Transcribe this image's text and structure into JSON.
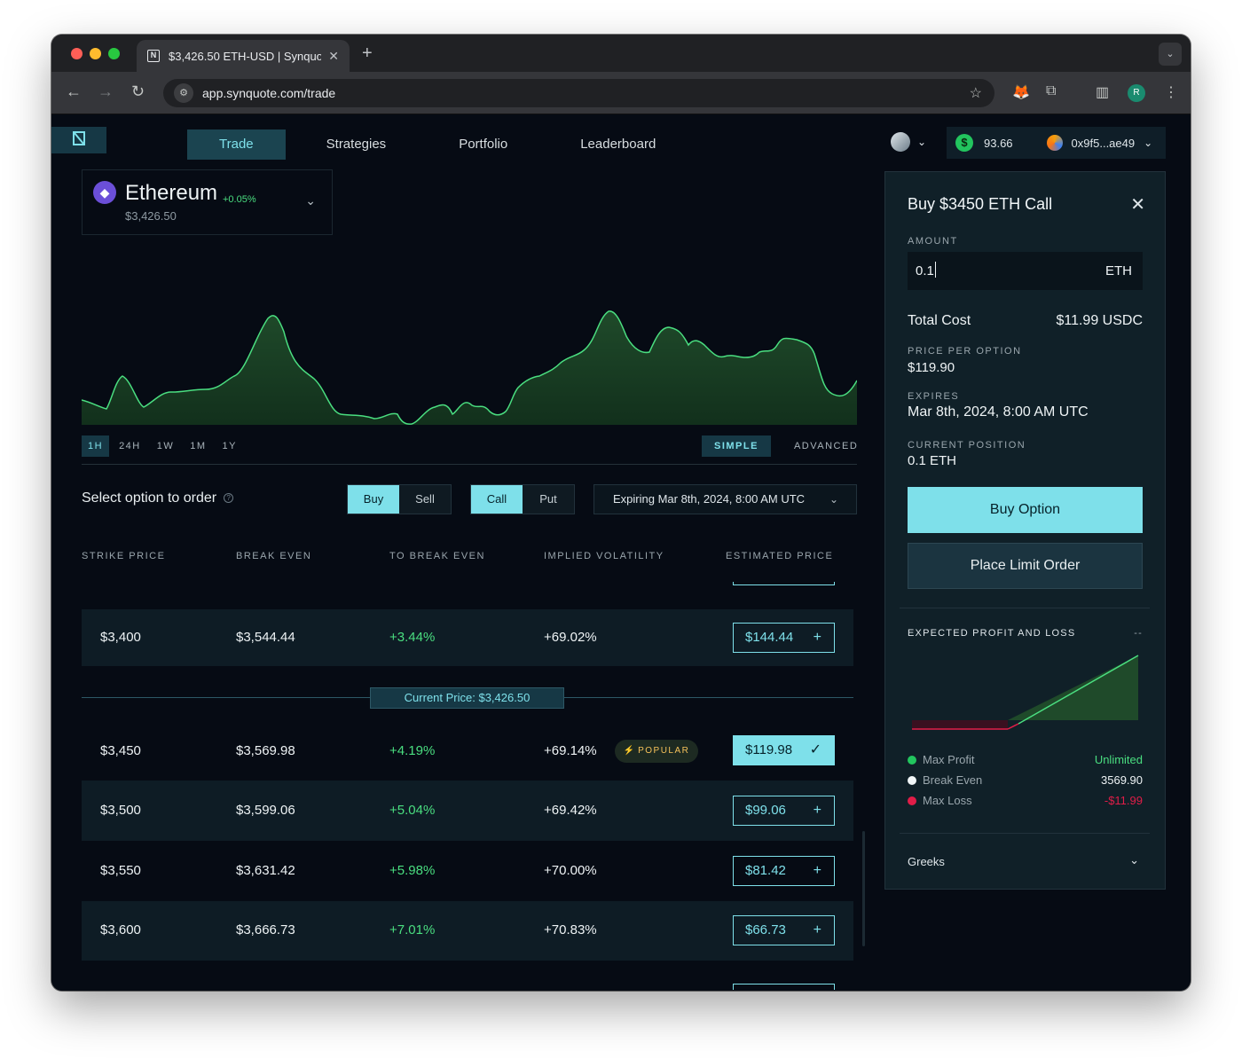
{
  "browser": {
    "tab_title": "$3,426.50 ETH-USD | Synquote",
    "url": "app.synquote.com/trade",
    "profile_initial": "R"
  },
  "app": {
    "logo": "ɴ",
    "nav": [
      "Trade",
      "Strategies",
      "Portfolio",
      "Leaderboard"
    ],
    "wallet": {
      "balance": "93.66",
      "address": "0x9f5...ae49"
    }
  },
  "asset": {
    "name": "Ethereum",
    "change": "+0.05%",
    "price": "$3,426.50"
  },
  "chart": {
    "ranges": [
      "1H",
      "24H",
      "1W",
      "1M",
      "1Y"
    ],
    "active_range": "1H",
    "modes": [
      "SIMPLE",
      "ADVANCED"
    ],
    "active_mode": "SIMPLE",
    "line_color": "#4ade80"
  },
  "order": {
    "label": "Select option to order",
    "help_icon": "?",
    "side": [
      "Buy",
      "Sell"
    ],
    "type": [
      "Call",
      "Put"
    ],
    "expiry": "Expiring Mar 8th, 2024, 8:00 AM UTC"
  },
  "table": {
    "headers": [
      "STRIKE PRICE",
      "BREAK EVEN",
      "TO BREAK EVEN",
      "IMPLIED VOLATILITY",
      "ESTIMATED PRICE"
    ],
    "rows": [
      {
        "strike": "$3,400",
        "break_even": "$3,544.44",
        "to_be": "+3.44%",
        "iv": "+69.02%",
        "price": "$144.44"
      },
      {
        "strike": "$3,450",
        "break_even": "$3,569.98",
        "to_be": "+4.19%",
        "iv": "+69.14%",
        "price": "$119.98",
        "badge": "POPULAR"
      },
      {
        "strike": "$3,500",
        "break_even": "$3,599.06",
        "to_be": "+5.04%",
        "iv": "+69.42%",
        "price": "$99.06"
      },
      {
        "strike": "$3,550",
        "break_even": "$3,631.42",
        "to_be": "+5.98%",
        "iv": "+70.00%",
        "price": "$81.42"
      },
      {
        "strike": "$3,600",
        "break_even": "$3,666.73",
        "to_be": "+7.01%",
        "iv": "+70.83%",
        "price": "$66.73"
      }
    ],
    "current_price": "Current Price: $3,426.50"
  },
  "panel": {
    "title": "Buy $3450 ETH Call",
    "amount_label": "AMOUNT",
    "amount_value": "0.1",
    "amount_unit": "ETH",
    "total_cost_label": "Total Cost",
    "total_cost": "$11.99 USDC",
    "ppo_label": "PRICE PER OPTION",
    "ppo": "$119.90",
    "expires_label": "EXPIRES",
    "expires": "Mar 8th, 2024, 8:00 AM UTC",
    "position_label": "CURRENT POSITION",
    "position": "0.1 ETH",
    "buy_button": "Buy Option",
    "limit_button": "Place Limit Order",
    "pnl_title": "EXPECTED PROFIT AND LOSS",
    "pnl_dash": "--",
    "legend": [
      {
        "label": "Max Profit",
        "value": "Unlimited",
        "color": "#22c55e"
      },
      {
        "label": "Break Even",
        "value": "3569.90",
        "color": "#f1f6f8"
      },
      {
        "label": "Max Loss",
        "value": "-$11.99",
        "color": "#e11d48"
      }
    ],
    "greeks": "Greeks"
  }
}
